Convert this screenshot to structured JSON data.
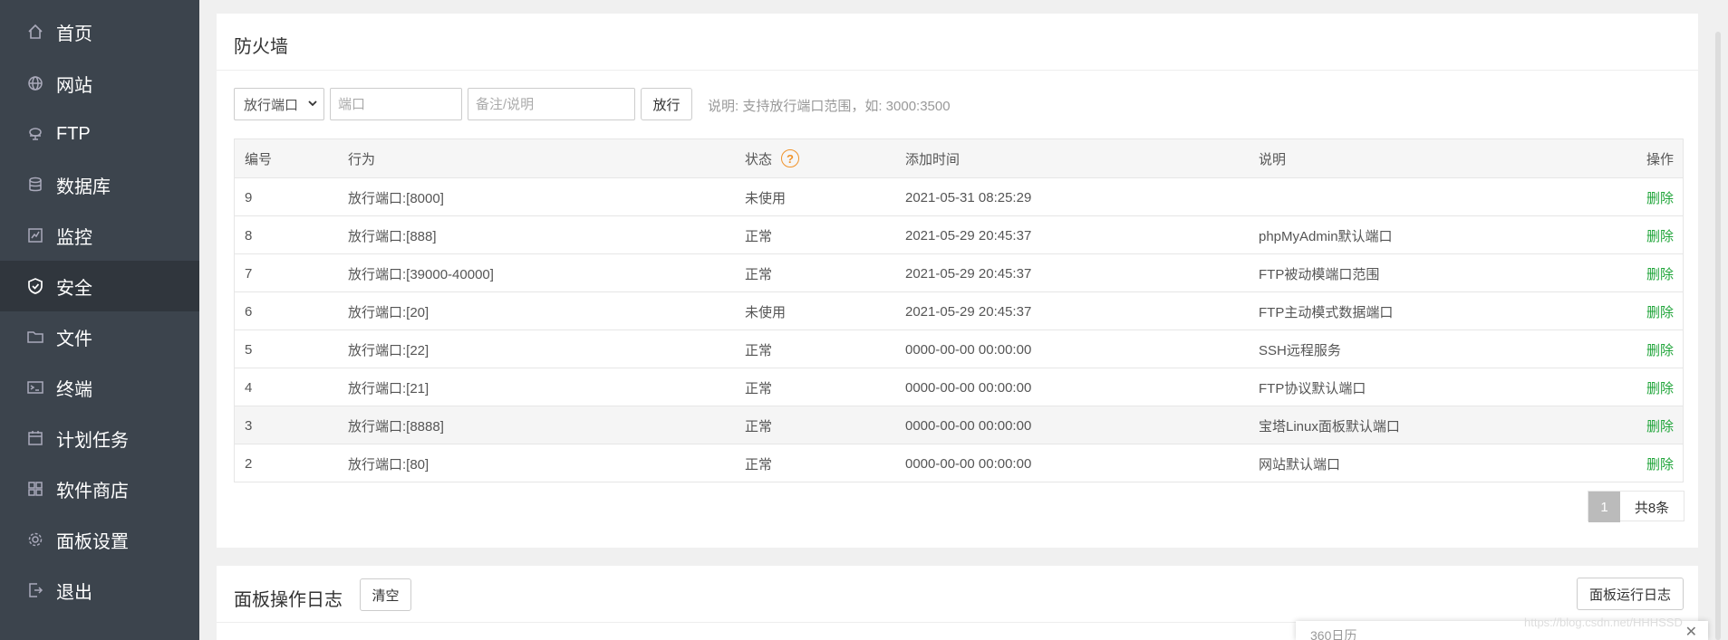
{
  "sidebar": {
    "items": [
      {
        "label": "首页",
        "icon": "home-icon",
        "active": false
      },
      {
        "label": "网站",
        "icon": "globe-icon",
        "active": false
      },
      {
        "label": "FTP",
        "icon": "ftp-icon",
        "active": false
      },
      {
        "label": "数据库",
        "icon": "database-icon",
        "active": false
      },
      {
        "label": "监控",
        "icon": "monitor-icon",
        "active": false
      },
      {
        "label": "安全",
        "icon": "shield-icon",
        "active": true
      },
      {
        "label": "文件",
        "icon": "folder-icon",
        "active": false
      },
      {
        "label": "终端",
        "icon": "terminal-icon",
        "active": false
      },
      {
        "label": "计划任务",
        "icon": "calendar-icon",
        "active": false
      },
      {
        "label": "软件商店",
        "icon": "grid-icon",
        "active": false
      },
      {
        "label": "面板设置",
        "icon": "gear-icon",
        "active": false
      },
      {
        "label": "退出",
        "icon": "logout-icon",
        "active": false
      }
    ]
  },
  "firewall": {
    "title": "防火墙",
    "select_value": "放行端口",
    "port_placeholder": "端口",
    "note_placeholder": "备注/说明",
    "allow_button": "放行",
    "hint": "说明: 支持放行端口范围，如: 3000:3500",
    "columns": [
      "编号",
      "行为",
      "状态",
      "添加时间",
      "说明",
      "操作"
    ],
    "rows": [
      {
        "id": "9",
        "action": "放行端口:[8000]",
        "status": "未使用",
        "time": "2021-05-31 08:25:29",
        "note": "",
        "op": "删除"
      },
      {
        "id": "8",
        "action": "放行端口:[888]",
        "status": "正常",
        "time": "2021-05-29 20:45:37",
        "note": "phpMyAdmin默认端口",
        "op": "删除"
      },
      {
        "id": "7",
        "action": "放行端口:[39000-40000]",
        "status": "正常",
        "time": "2021-05-29 20:45:37",
        "note": "FTP被动模端口范围",
        "op": "删除"
      },
      {
        "id": "6",
        "action": "放行端口:[20]",
        "status": "未使用",
        "time": "2021-05-29 20:45:37",
        "note": "FTP主动模式数据端口",
        "op": "删除"
      },
      {
        "id": "5",
        "action": "放行端口:[22]",
        "status": "正常",
        "time": "0000-00-00 00:00:00",
        "note": "SSH远程服务",
        "op": "删除"
      },
      {
        "id": "4",
        "action": "放行端口:[21]",
        "status": "正常",
        "time": "0000-00-00 00:00:00",
        "note": "FTP协议默认端口",
        "op": "删除"
      },
      {
        "id": "3",
        "action": "放行端口:[8888]",
        "status": "正常",
        "time": "0000-00-00 00:00:00",
        "note": "宝塔Linux面板默认端口",
        "op": "删除"
      },
      {
        "id": "2",
        "action": "放行端口:[80]",
        "status": "正常",
        "time": "0000-00-00 00:00:00",
        "note": "网站默认端口",
        "op": "删除"
      }
    ],
    "pager": {
      "current": "1",
      "total": "共8条"
    }
  },
  "logs": {
    "title": "面板操作日志",
    "clear_button": "清空",
    "run_log_button": "面板运行日志"
  },
  "popup": {
    "text": "360日历"
  },
  "watermark": "https://blog.csdn.net/HHHSSD"
}
